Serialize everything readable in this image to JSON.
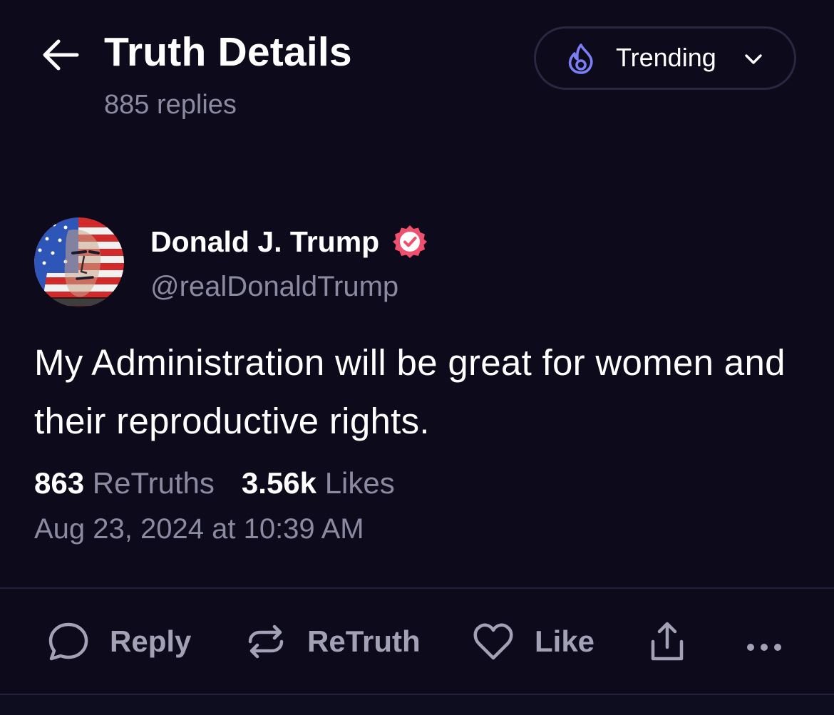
{
  "header": {
    "title": "Truth Details",
    "reply_count": "885 replies",
    "sort": {
      "label": "Trending",
      "icon": "fire-icon",
      "accent": "#7b7ff5"
    }
  },
  "post": {
    "author": {
      "display_name": "Donald J. Trump",
      "handle": "@realDonaldTrump",
      "verified": true,
      "verified_color": "#f0506e"
    },
    "text": "My Administration will be great for women and their reproductive rights.",
    "stats": {
      "retruths_count": "863",
      "retruths_label": "ReTruths",
      "likes_count": "3.56k",
      "likes_label": "Likes"
    },
    "timestamp": "Aug 23, 2024 at 10:39 AM"
  },
  "actions": {
    "reply": {
      "label": "Reply",
      "icon": "comment-icon"
    },
    "retruth": {
      "label": "ReTruth",
      "icon": "retruth-icon"
    },
    "like": {
      "label": "Like",
      "icon": "heart-icon"
    },
    "share": {
      "icon": "share-icon"
    },
    "more": {
      "icon": "more-icon"
    }
  },
  "theme": {
    "background": "#0c0a1b",
    "text": "#ffffff",
    "muted": "#8c8aa0",
    "divider": "#23213a"
  }
}
